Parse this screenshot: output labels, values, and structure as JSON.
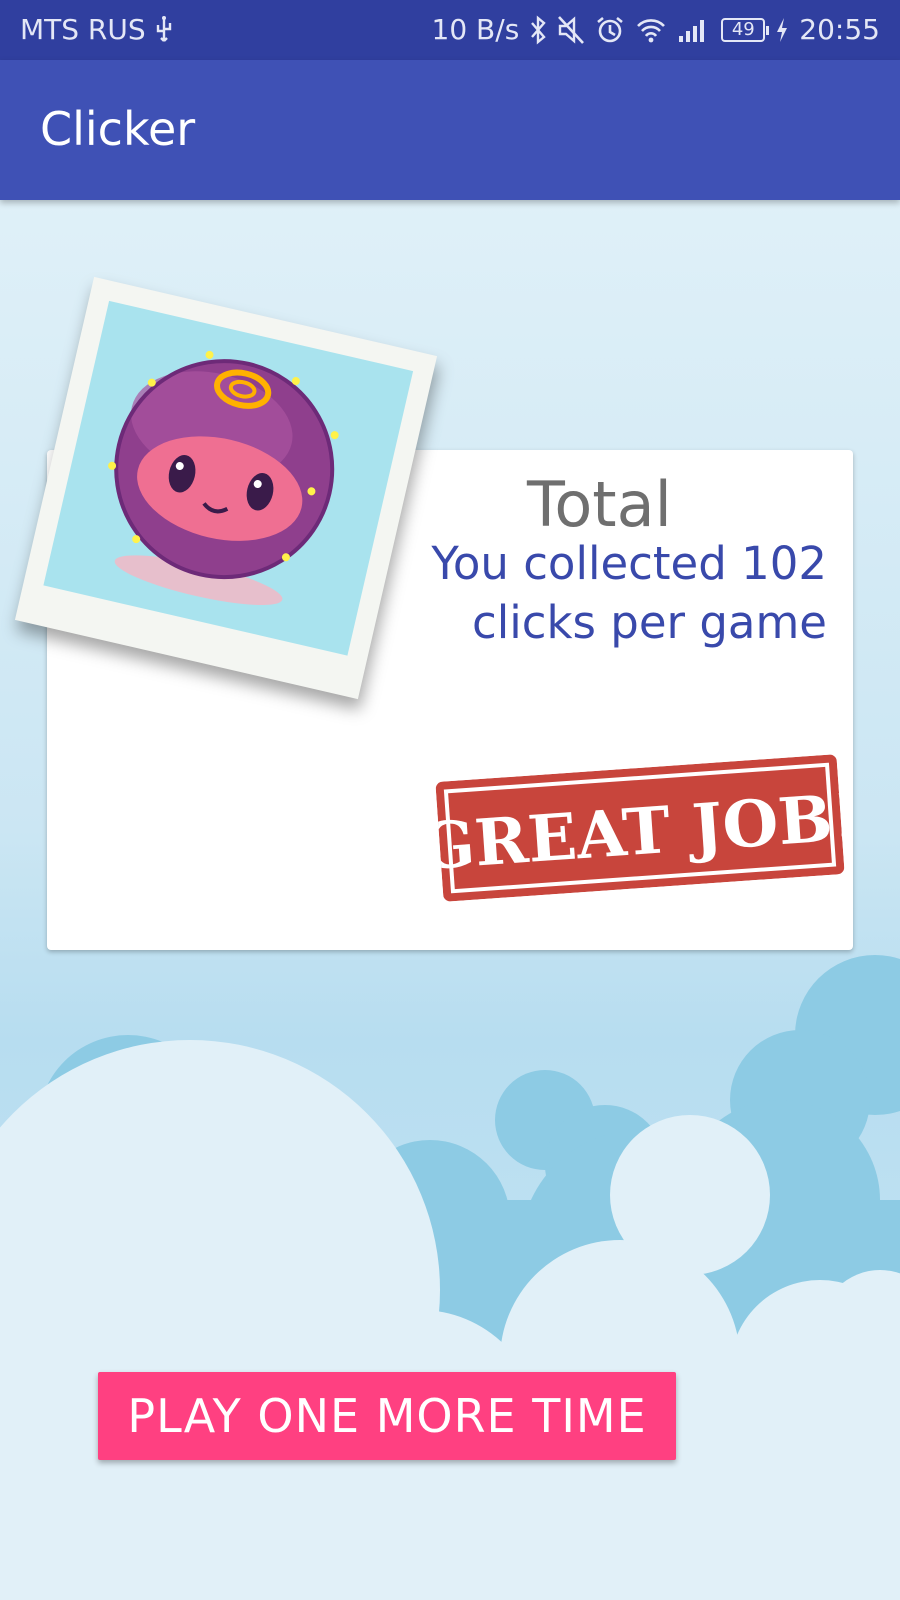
{
  "status_bar": {
    "carrier": "MTS RUS",
    "network_speed": "10 B/s",
    "battery": "49",
    "time": "20:55",
    "icons": [
      "usb-icon",
      "bluetooth-icon",
      "mute-icon",
      "alarm-icon",
      "wifi-icon",
      "signal-icon",
      "battery-icon",
      "charging-icon"
    ]
  },
  "app_bar": {
    "title": "Clicker"
  },
  "result": {
    "heading": "Total",
    "line1": "You collected 102",
    "line2": "clicks per game",
    "stamp": "GREAT JOB!"
  },
  "actions": {
    "play_again_label": "PLAY ONE MORE TIME"
  },
  "colors": {
    "status_bar": "#303f9f",
    "app_bar": "#3f51b5",
    "score_text": "#3949ab",
    "button": "#ff4081",
    "stamp": "#c8453c"
  }
}
